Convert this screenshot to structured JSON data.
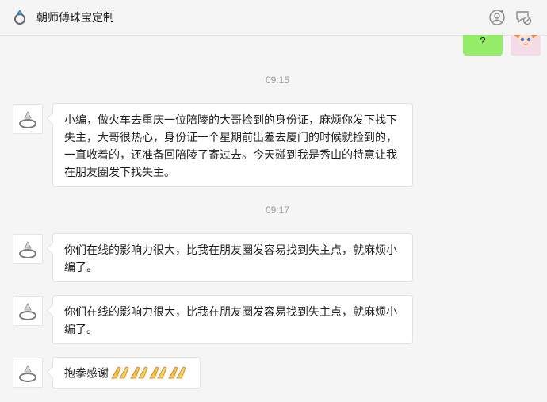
{
  "header": {
    "title": "朝师傅珠宝定制",
    "icons": [
      "ring-logo-icon",
      "add-contact-icon",
      "chat-settings-icon"
    ]
  },
  "self_message": {
    "text": "?"
  },
  "timestamps": [
    "09:15",
    "09:17"
  ],
  "messages": [
    {
      "text": "小编，做火车去重庆一位陪陵的大哥捡到的身份证，麻烦你发下找下失主，大哥很热心，身份证一个星期前出差去厦门的时候就捡到的，一直收着的，还准备回陪陵了寄过去。今天碰到我是秀山的特意让我在朋友圈发下找失主。"
    },
    {
      "text": "你们在线的影响力很大，比我在朋友圈发容易找到失主点，就麻烦小编了。"
    },
    {
      "text": "你们在线的影响力很大，比我在朋友圈发容易找到失主点，就麻烦小编了。"
    },
    {
      "text": "抱拳感谢",
      "emoji": "clap-hands-icon",
      "emoji_count": 4
    }
  ],
  "colors": {
    "self_bubble": "#95ec69",
    "background": "#f5f5f5",
    "time": "#9a9a9a"
  }
}
